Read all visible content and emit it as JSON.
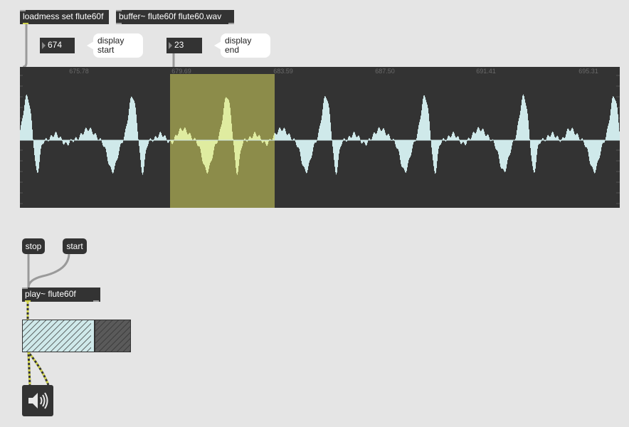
{
  "objects": {
    "loadmess": "loadmess set flute60f",
    "buffer": "buffer~ flute60f flute60.wav",
    "play": "play~ flute60f"
  },
  "number_boxes": {
    "start_value": "674",
    "end_value": "23"
  },
  "comments": {
    "start_line1": "display",
    "start_line2": "start",
    "end_line1": "display",
    "end_line2": "end"
  },
  "messages": {
    "stop": "stop",
    "start": "start"
  },
  "waveform": {
    "time_labels": [
      "675.78",
      "679.69",
      "683.59",
      "687.50",
      "691.41",
      "695.31"
    ],
    "background_color": "#333333",
    "wave_color": "#cfe9ea",
    "selection_color": "#8c8c4a",
    "selection_wave_color": "#dfeca0"
  },
  "icons": {
    "speaker": "speaker-icon"
  }
}
